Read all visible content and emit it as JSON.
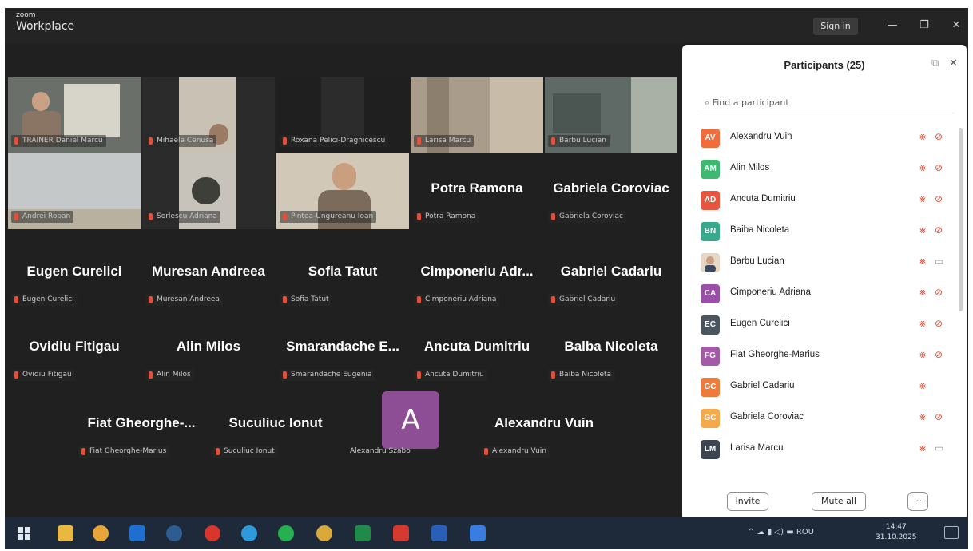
{
  "window": {
    "brand_small": "zoom",
    "brand_big": "Workplace",
    "sign_in": "Sign in",
    "minimize": "—",
    "restore": "❐",
    "close": "✕"
  },
  "tiles": [
    {
      "tag": "TRAINER Daniel Marcu"
    },
    {
      "tag": "Mihaela Cenusa"
    },
    {
      "tag": "Roxana Pelici-Draghicescu"
    },
    {
      "tag": "Larisa Marcu"
    },
    {
      "tag": "Barbu Lucian"
    },
    {
      "tag": "Andrei Ropan"
    },
    {
      "tag": "Sorlescu Adriana"
    },
    {
      "tag": "Pintea-Ungureanu Ioan"
    },
    {
      "big": "Potra Ramona",
      "tag": "Potra Ramona"
    },
    {
      "big": "Gabriela Coroviac",
      "tag": "Gabriela Coroviac"
    },
    {
      "big": "Eugen Curelici",
      "tag": "Eugen Curelici"
    },
    {
      "big": "Muresan Andreea",
      "tag": "Muresan Andreea"
    },
    {
      "big": "Sofia Tatut",
      "tag": "Sofia Tatut"
    },
    {
      "big": "Cimponeriu  Adr...",
      "tag": "Cimponeriu Adriana"
    },
    {
      "big": "Gabriel Cadariu",
      "tag": "Gabriel Cadariu"
    },
    {
      "big": "Ovidiu Fitigau",
      "tag": "Ovidiu Fitigau"
    },
    {
      "big": "Alin Milos",
      "tag": "Alin Milos"
    },
    {
      "big": "Smarandache  E...",
      "tag": "Smarandache Eugenia"
    },
    {
      "big": "Ancuta Dumitriu",
      "tag": "Ancuta Dumitriu"
    },
    {
      "big": "Balba Nicoleta",
      "tag": "Baiba Nicoleta"
    },
    {
      "big": "Fiat  Gheorghe-...",
      "tag": "Fiat Gheorghe-Marius"
    },
    {
      "big": "Suculiuc Ionut",
      "tag": "Suculiuc Ionut"
    },
    {
      "avatar": "A",
      "tag": "Alexandru Szabo"
    },
    {
      "big": "Alexandru Vuin",
      "tag": "Alexandru Vuin"
    }
  ],
  "participants_panel": {
    "title": "Participants (25)",
    "popout_icon": "⧉",
    "close_icon": "✕",
    "search_placeholder": "Find a participant",
    "participants": [
      {
        "initials": "AV",
        "name": "Alexandru Vuin",
        "color": "#f26b3a",
        "cam": "off"
      },
      {
        "initials": "AM",
        "name": "Alin Milos",
        "color": "#3fb871",
        "cam": "off"
      },
      {
        "initials": "AD",
        "name": "Ancuta Dumitriu",
        "color": "#e8553f",
        "cam": "off"
      },
      {
        "initials": "BN",
        "name": "Baiba Nicoleta",
        "color": "#3aa88c",
        "cam": "off"
      },
      {
        "initials": "",
        "name": "Barbu Lucian",
        "color": "#e8d6c4",
        "cam": "on"
      },
      {
        "initials": "CA",
        "name": "Cimponeriu Adriana",
        "color": "#9a4ea8",
        "cam": "off"
      },
      {
        "initials": "EC",
        "name": "Eugen Curelici",
        "color": "#4a5560",
        "cam": "off"
      },
      {
        "initials": "FG",
        "name": "Fiat Gheorghe-Marius",
        "color": "#a35aa8",
        "cam": "off"
      },
      {
        "initials": "GC",
        "name": "Gabriel Cadariu",
        "color": "#f07a3a",
        "cam": "none"
      },
      {
        "initials": "GC",
        "name": "Gabriela Coroviac",
        "color": "#f5a94a",
        "cam": "off"
      },
      {
        "initials": "LM",
        "name": "Larisa Marcu",
        "color": "#3d4650",
        "cam": "on"
      }
    ],
    "invite": "Invite",
    "mute_all": "Mute all",
    "more": "···"
  },
  "taskbar": {
    "tray_text": "^  ☁  ▮  ◁)  ▬  ROU",
    "time": "14:47",
    "date": "31.10.2025",
    "apps": [
      "windows-start",
      "file-explorer",
      "chrome",
      "outlook",
      "cortana",
      "opera",
      "edge",
      "whatsapp",
      "chrome-canary",
      "excel",
      "acrobat",
      "word",
      "zoom"
    ]
  },
  "colors": {
    "muted_red": "#e0513a",
    "active_speaker_green": "#5fd35f",
    "avatar_purple": "#8e4e95"
  }
}
